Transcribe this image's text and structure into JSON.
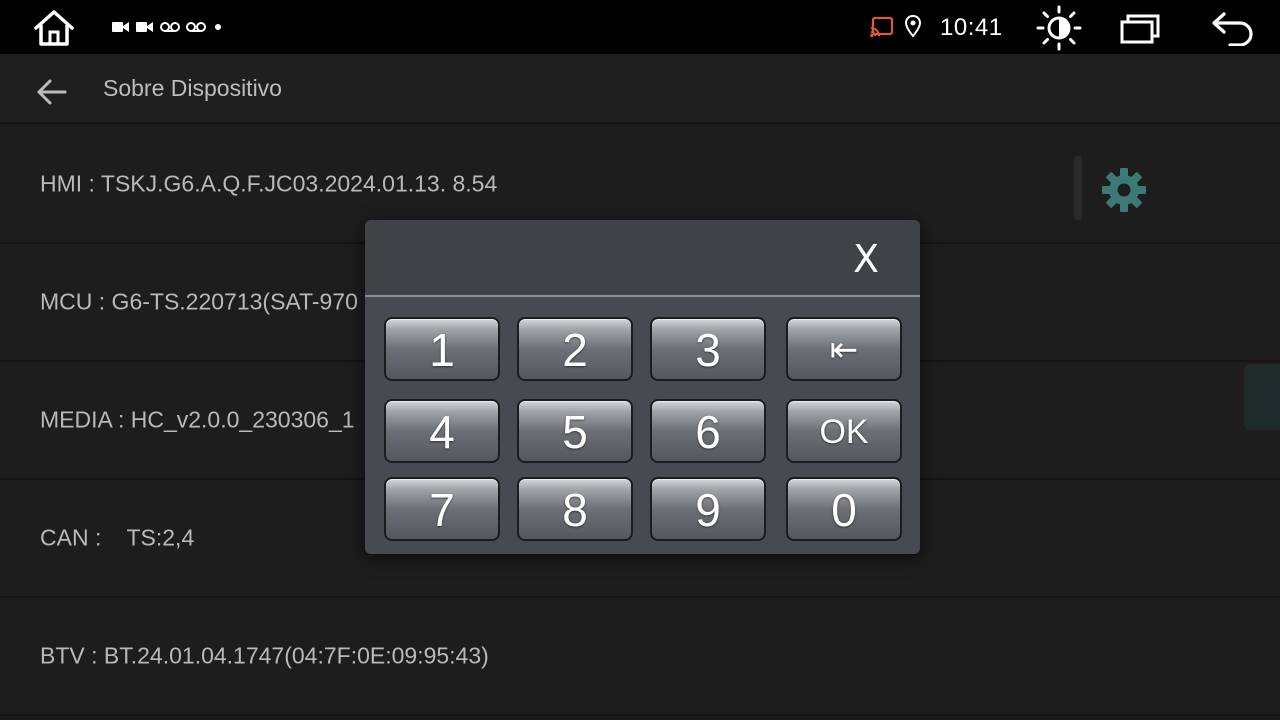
{
  "statusbar": {
    "time": "10:41",
    "notification_icons": [
      "video-icon",
      "video-icon",
      "voicemail-icon",
      "voicemail-icon",
      "dot-icon"
    ]
  },
  "header": {
    "title": "Sobre Dispositivo"
  },
  "rows": [
    {
      "label": "HMI : TSKJ.G6.A.Q.F.JC03.2024.01.13. 8.54"
    },
    {
      "label": "MCU : G6-TS.220713(SAT-970"
    },
    {
      "label": "MEDIA : HC_v2.0.0_230306_1"
    },
    {
      "label": "CAN :    TS:2,4"
    },
    {
      "label": "BTV : BT.24.01.04.1747(04:7F:0E:09:95:43)"
    }
  ],
  "keypad": {
    "close_label": "X",
    "keys": [
      "1",
      "2",
      "3",
      "⇤",
      "4",
      "5",
      "6",
      "OK",
      "7",
      "8",
      "9",
      "0"
    ]
  },
  "colors": {
    "accent_gear": "#3d7a76",
    "background": "#1b1b1b",
    "statusbar": "#000000"
  }
}
